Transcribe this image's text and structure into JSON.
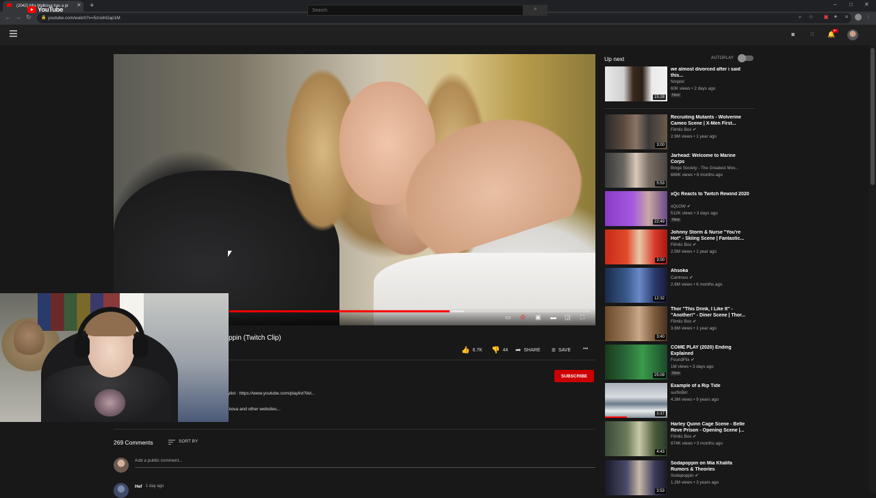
{
  "browser": {
    "tab_title": "(2042) Mia Malkova has a pr",
    "url": "youtube.com/watch?v=5zroihGap1M"
  },
  "header": {
    "logo_text": "YouTube",
    "search_placeholder": "Search",
    "notification_count": "9+"
  },
  "video": {
    "title_visible": "ppin (Twitch Clip)",
    "progress": 0.61,
    "buffered": 0.65
  },
  "actions": {
    "likes": "6.7K",
    "dislikes": "44",
    "share": "SHARE",
    "save": "SAVE",
    "more": "•••"
  },
  "channel": {
    "subscribe_label": "SUBSCRIBE"
  },
  "description": {
    "line1": "ylist : https://www.youtube.com/playlist?list...",
    "line2": "lkova and other websites..."
  },
  "comments": {
    "count": "269 Comments",
    "sort_label": "SORT BY",
    "add_placeholder": "Add a public comment...",
    "first_author": "Hef",
    "first_date": "1 day ago"
  },
  "sidebar": {
    "up_next": "Up next",
    "autoplay": "AUTOPLAY",
    "autoplay_on": false,
    "items": [
      {
        "title": "we almost divorced after i said this...",
        "channel": "Nmplol",
        "meta": "60K views • 2 days ago",
        "badge": "New",
        "duration": "15:28",
        "verified": false,
        "thumb": "linear-gradient(90deg,#e8e8e8 0%,#d0d0d0 30%,#3a2a1e 45%,#2a1e14 60%,#eaeaea 75%,#f2f2f2 100%)"
      },
      {
        "title": "Recruiting Mutants - Wolverine Cameo Scene | X-Men First...",
        "channel": "Filmlic Box",
        "meta": "2.9M views • 1 year ago",
        "badge": "",
        "duration": "3:00",
        "verified": true,
        "thumb": "linear-gradient(90deg,#2a2a2a 0%,#5a4a3e 30%,#8a7464 50%,#3a3a3a 70%,#6a5a4a 100%)"
      },
      {
        "title": "Jarhead: Welcome to Marine Corps",
        "channel": "Binge Society - The Greatest Mov...",
        "meta": "669K views • 6 months ago",
        "badge": "",
        "duration": "5:53",
        "verified": false,
        "thumb": "linear-gradient(90deg,#3a3a3a 0%,#6a6660 30%,#d8c8b8 50%,#7a7066 70%,#4a4440 100%)"
      },
      {
        "title": "xQc Reacts to Twitch Rewind 2020",
        "channel": "xQcOW",
        "meta": "512K views • 3 days ago",
        "badge": "New",
        "duration": "22:49",
        "verified": true,
        "thumb": "linear-gradient(90deg,#8a3ac8 0%,#a65ae0 45%,#c8a8a0 70%,#6a4a8a 100%)"
      },
      {
        "title": "Johnny Storm & Nurse \"You're Hot\" - Skiing Scene | Fantastic...",
        "channel": "Filmlic Box",
        "meta": "2.5M views • 1 year ago",
        "badge": "",
        "duration": "3:00",
        "verified": true,
        "thumb": "linear-gradient(90deg,#c82a1a 0%,#e04a2a 35%,#e8c8a8 55%,#d83a2a 80%,#a81a10 100%)"
      },
      {
        "title": "Ahsoka",
        "channel": "Cantrous",
        "meta": "2.6M views • 6 months ago",
        "badge": "",
        "duration": "12:32",
        "verified": true,
        "thumb": "linear-gradient(90deg,#1a2a4a 0%,#3a5a8a 35%,#6a8ac8 55%,#2a3a6a 80%,#1a1a3a 100%)"
      },
      {
        "title": "Thor \"This Drink, I Like It\" - \"Another!\" - Diner Scene | Thor...",
        "channel": "Filmlic Box",
        "meta": "3.6M views • 1 year ago",
        "badge": "",
        "duration": "3:40",
        "verified": true,
        "thumb": "linear-gradient(90deg,#6a4a2a 0%,#9a7a5a 35%,#c8a888 55%,#7a5a3a 80%,#4a3020 100%)"
      },
      {
        "title": "COME PLAY (2020) Ending Explained",
        "channel": "FoundFlix",
        "meta": "1M views • 3 days ago",
        "badge": "New",
        "duration": "25:09",
        "verified": true,
        "thumb": "linear-gradient(90deg,#1a3a1a 0%,#2a6a3a 35%,#3a9a4a 60%,#1a4a2a 100%)"
      },
      {
        "title": "Example of a Rip Tide",
        "channel": "surfinBirr",
        "meta": "4.3M views • 9 years ago",
        "badge": "",
        "duration": "1:17",
        "verified": false,
        "watched": 0.35,
        "thumb": "linear-gradient(180deg,#a8b0b8 0%,#d8dce0 40%,#6a7a8a 60%,#e8ecee 80%,#8a969e 100%)"
      },
      {
        "title": "Harley Quinn Cage Scene - Belle Reve Prison - Opening Scene |...",
        "channel": "Filmlic Box",
        "meta": "874K views • 3 months ago",
        "badge": "",
        "duration": "4:43",
        "verified": true,
        "thumb": "linear-gradient(90deg,#3a4a3a 0%,#6a7a5a 35%,#c8c8a8 55%,#4a5a3a 80%,#2a3a2a 100%)"
      },
      {
        "title": "Sodapoppin on Mia Khalifa Rumors & Theories",
        "channel": "Sodapoppin",
        "meta": "1.2M views • 3 years ago",
        "badge": "",
        "duration": "3:53",
        "verified": true,
        "thumb": "linear-gradient(90deg,#1a1a2a 0%,#4a4a6a 35%,#c8b8a8 55%,#3a3a5a 80%,#1a1a2a 100%)"
      }
    ]
  },
  "accent_red": "#ff0000"
}
